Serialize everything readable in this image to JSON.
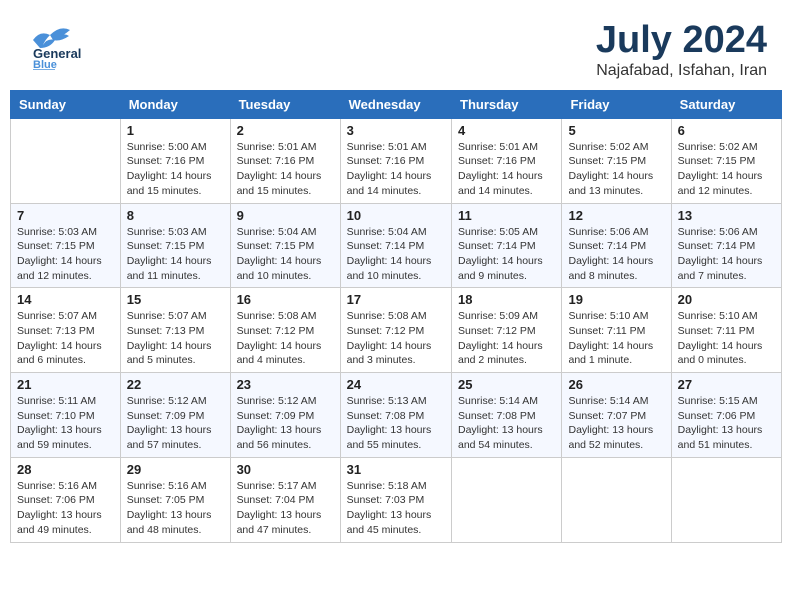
{
  "header": {
    "logo_general": "General",
    "logo_blue": "Blue",
    "main_title": "July 2024",
    "subtitle": "Najafabad, Isfahan, Iran"
  },
  "calendar": {
    "columns": [
      "Sunday",
      "Monday",
      "Tuesday",
      "Wednesday",
      "Thursday",
      "Friday",
      "Saturday"
    ],
    "weeks": [
      {
        "days": [
          {
            "num": "",
            "detail": ""
          },
          {
            "num": "1",
            "detail": "Sunrise: 5:00 AM\nSunset: 7:16 PM\nDaylight: 14 hours\nand 15 minutes."
          },
          {
            "num": "2",
            "detail": "Sunrise: 5:01 AM\nSunset: 7:16 PM\nDaylight: 14 hours\nand 15 minutes."
          },
          {
            "num": "3",
            "detail": "Sunrise: 5:01 AM\nSunset: 7:16 PM\nDaylight: 14 hours\nand 14 minutes."
          },
          {
            "num": "4",
            "detail": "Sunrise: 5:01 AM\nSunset: 7:16 PM\nDaylight: 14 hours\nand 14 minutes."
          },
          {
            "num": "5",
            "detail": "Sunrise: 5:02 AM\nSunset: 7:15 PM\nDaylight: 14 hours\nand 13 minutes."
          },
          {
            "num": "6",
            "detail": "Sunrise: 5:02 AM\nSunset: 7:15 PM\nDaylight: 14 hours\nand 12 minutes."
          }
        ]
      },
      {
        "days": [
          {
            "num": "7",
            "detail": "Sunrise: 5:03 AM\nSunset: 7:15 PM\nDaylight: 14 hours\nand 12 minutes."
          },
          {
            "num": "8",
            "detail": "Sunrise: 5:03 AM\nSunset: 7:15 PM\nDaylight: 14 hours\nand 11 minutes."
          },
          {
            "num": "9",
            "detail": "Sunrise: 5:04 AM\nSunset: 7:15 PM\nDaylight: 14 hours\nand 10 minutes."
          },
          {
            "num": "10",
            "detail": "Sunrise: 5:04 AM\nSunset: 7:14 PM\nDaylight: 14 hours\nand 10 minutes."
          },
          {
            "num": "11",
            "detail": "Sunrise: 5:05 AM\nSunset: 7:14 PM\nDaylight: 14 hours\nand 9 minutes."
          },
          {
            "num": "12",
            "detail": "Sunrise: 5:06 AM\nSunset: 7:14 PM\nDaylight: 14 hours\nand 8 minutes."
          },
          {
            "num": "13",
            "detail": "Sunrise: 5:06 AM\nSunset: 7:14 PM\nDaylight: 14 hours\nand 7 minutes."
          }
        ]
      },
      {
        "days": [
          {
            "num": "14",
            "detail": "Sunrise: 5:07 AM\nSunset: 7:13 PM\nDaylight: 14 hours\nand 6 minutes."
          },
          {
            "num": "15",
            "detail": "Sunrise: 5:07 AM\nSunset: 7:13 PM\nDaylight: 14 hours\nand 5 minutes."
          },
          {
            "num": "16",
            "detail": "Sunrise: 5:08 AM\nSunset: 7:12 PM\nDaylight: 14 hours\nand 4 minutes."
          },
          {
            "num": "17",
            "detail": "Sunrise: 5:08 AM\nSunset: 7:12 PM\nDaylight: 14 hours\nand 3 minutes."
          },
          {
            "num": "18",
            "detail": "Sunrise: 5:09 AM\nSunset: 7:12 PM\nDaylight: 14 hours\nand 2 minutes."
          },
          {
            "num": "19",
            "detail": "Sunrise: 5:10 AM\nSunset: 7:11 PM\nDaylight: 14 hours\nand 1 minute."
          },
          {
            "num": "20",
            "detail": "Sunrise: 5:10 AM\nSunset: 7:11 PM\nDaylight: 14 hours\nand 0 minutes."
          }
        ]
      },
      {
        "days": [
          {
            "num": "21",
            "detail": "Sunrise: 5:11 AM\nSunset: 7:10 PM\nDaylight: 13 hours\nand 59 minutes."
          },
          {
            "num": "22",
            "detail": "Sunrise: 5:12 AM\nSunset: 7:09 PM\nDaylight: 13 hours\nand 57 minutes."
          },
          {
            "num": "23",
            "detail": "Sunrise: 5:12 AM\nSunset: 7:09 PM\nDaylight: 13 hours\nand 56 minutes."
          },
          {
            "num": "24",
            "detail": "Sunrise: 5:13 AM\nSunset: 7:08 PM\nDaylight: 13 hours\nand 55 minutes."
          },
          {
            "num": "25",
            "detail": "Sunrise: 5:14 AM\nSunset: 7:08 PM\nDaylight: 13 hours\nand 54 minutes."
          },
          {
            "num": "26",
            "detail": "Sunrise: 5:14 AM\nSunset: 7:07 PM\nDaylight: 13 hours\nand 52 minutes."
          },
          {
            "num": "27",
            "detail": "Sunrise: 5:15 AM\nSunset: 7:06 PM\nDaylight: 13 hours\nand 51 minutes."
          }
        ]
      },
      {
        "days": [
          {
            "num": "28",
            "detail": "Sunrise: 5:16 AM\nSunset: 7:06 PM\nDaylight: 13 hours\nand 49 minutes."
          },
          {
            "num": "29",
            "detail": "Sunrise: 5:16 AM\nSunset: 7:05 PM\nDaylight: 13 hours\nand 48 minutes."
          },
          {
            "num": "30",
            "detail": "Sunrise: 5:17 AM\nSunset: 7:04 PM\nDaylight: 13 hours\nand 47 minutes."
          },
          {
            "num": "31",
            "detail": "Sunrise: 5:18 AM\nSunset: 7:03 PM\nDaylight: 13 hours\nand 45 minutes."
          },
          {
            "num": "",
            "detail": ""
          },
          {
            "num": "",
            "detail": ""
          },
          {
            "num": "",
            "detail": ""
          }
        ]
      }
    ]
  }
}
